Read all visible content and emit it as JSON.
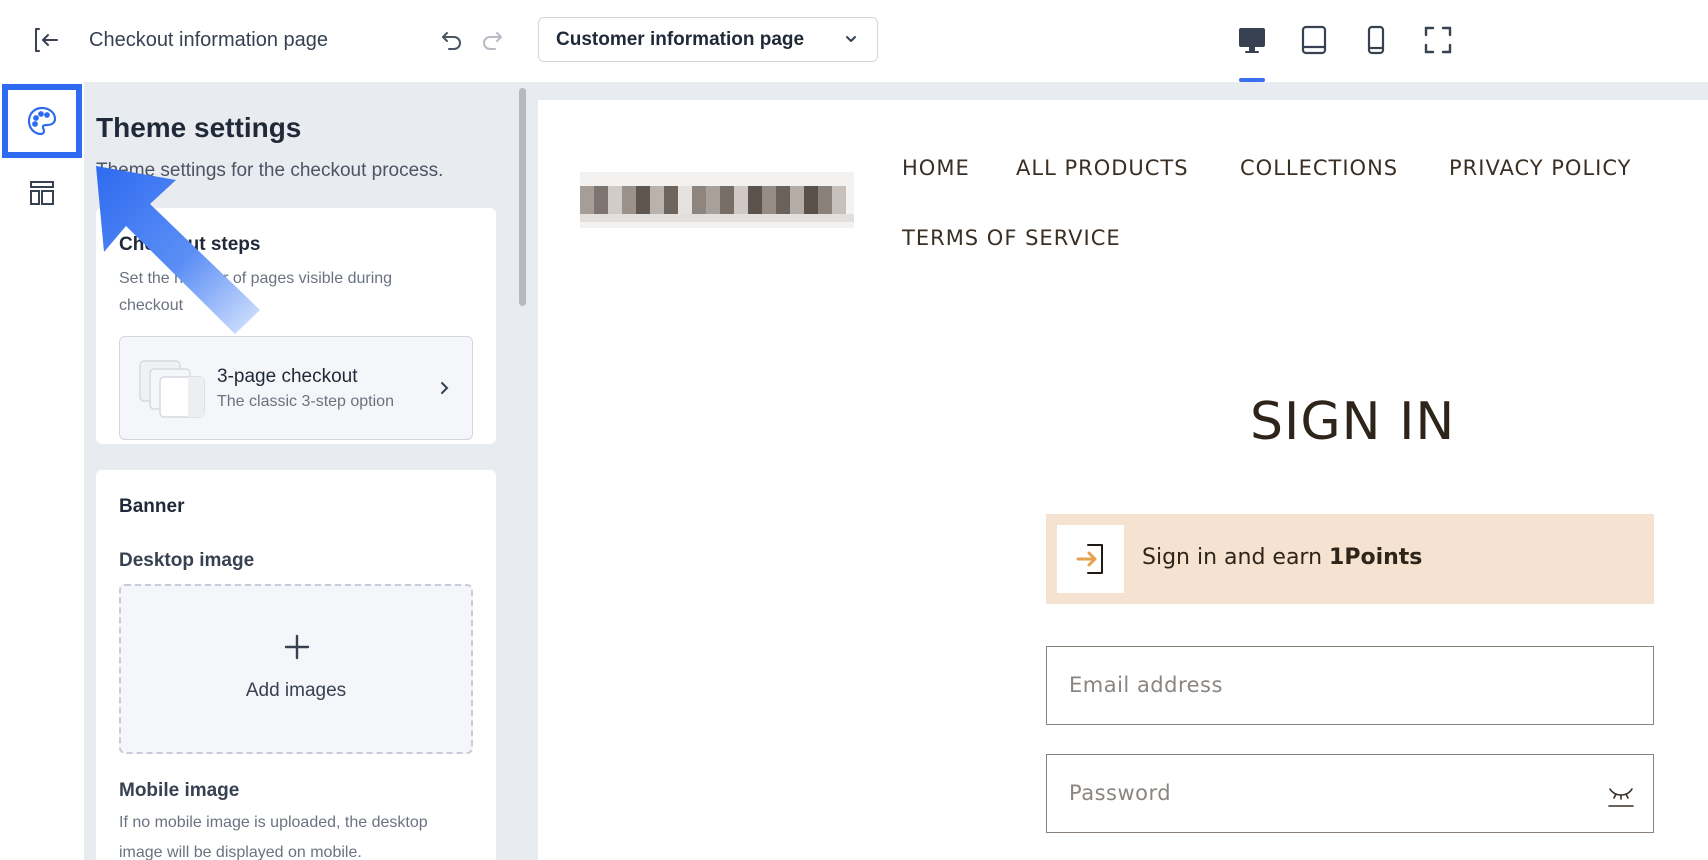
{
  "header": {
    "page_name": "Checkout information page",
    "page_selector": {
      "selected": "Customer information page"
    },
    "devices": [
      {
        "icon": "desktop-icon",
        "active": true
      },
      {
        "icon": "tablet-icon",
        "active": false
      },
      {
        "icon": "mobile-icon",
        "active": false
      },
      {
        "icon": "fullscreen-icon",
        "active": false
      }
    ],
    "accent_color": "#3b6ff0"
  },
  "rail": {
    "items": [
      {
        "icon": "palette-icon",
        "active": true
      },
      {
        "icon": "layout-icon",
        "active": false
      }
    ],
    "highlight_color": "#2f6bf0"
  },
  "panel": {
    "title": "Theme settings",
    "subtitle": "Theme settings for the checkout process.",
    "checkout_steps": {
      "heading": "Checkout steps",
      "description": "Set the number of pages visible during checkout",
      "option_title": "3-page checkout",
      "option_desc": "The classic 3-step option"
    },
    "banner": {
      "heading": "Banner",
      "desktop_label": "Desktop image",
      "add_images": "Add images",
      "mobile_label": "Mobile image",
      "mobile_desc": "If no mobile image is uploaded, the desktop image will be displayed on mobile."
    }
  },
  "preview": {
    "nav": [
      "HOME",
      "ALL PRODUCTS",
      "COLLECTIONS",
      "PRIVACY POLICY",
      "TERMS OF SERVICE"
    ],
    "signin_title": "SIGN IN",
    "earn_text": "Sign in and earn ",
    "earn_points": "1Points",
    "email_placeholder": "Email address",
    "password_placeholder": "Password",
    "earn_bg_color": "#f5e2d1",
    "earn_icon_color": "#e6a24f"
  }
}
